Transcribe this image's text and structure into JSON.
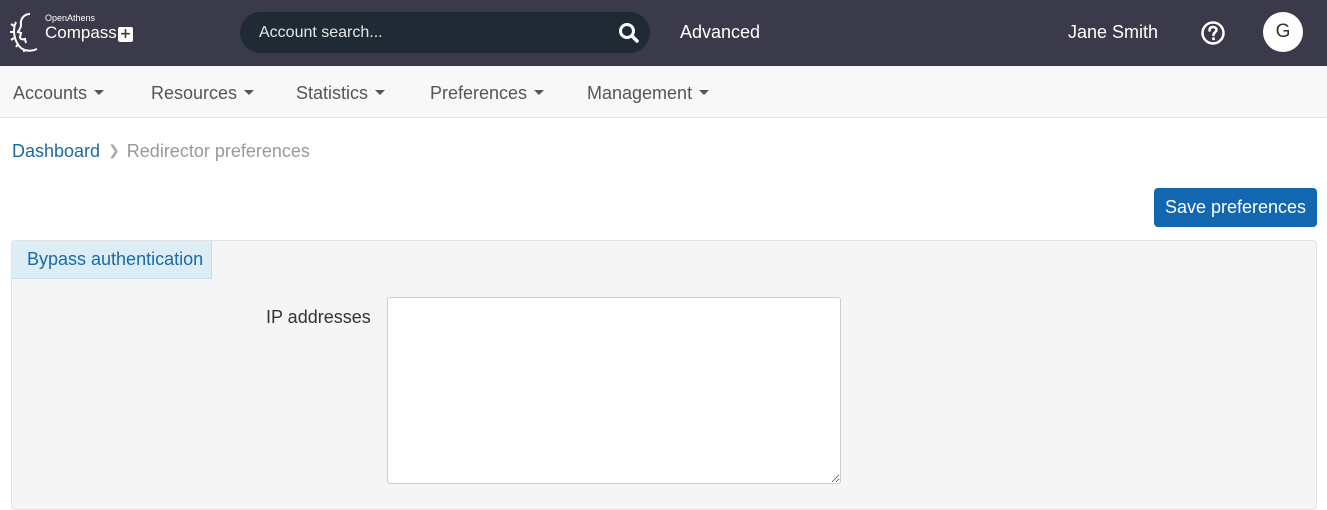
{
  "header": {
    "brand_small": "OpenAthens",
    "brand_name": "Compass",
    "search_placeholder": "Account search...",
    "advanced_label": "Advanced",
    "user_name": "Jane Smith",
    "avatar_initial": "G",
    "icons": {
      "search": "search-icon",
      "help": "help-circle-icon",
      "logo": "laurel-head-icon",
      "plus": "plus-box-icon"
    }
  },
  "nav": {
    "items": [
      {
        "label": "Accounts"
      },
      {
        "label": "Resources"
      },
      {
        "label": "Statistics"
      },
      {
        "label": "Preferences"
      },
      {
        "label": "Management"
      }
    ]
  },
  "breadcrumb": {
    "parent": "Dashboard",
    "current": "Redirector preferences"
  },
  "actions": {
    "save_label": "Save preferences"
  },
  "panel": {
    "tab_label": "Bypass authentication",
    "field_label": "IP addresses",
    "field_value": ""
  },
  "colors": {
    "header_bg": "#3b3a4a",
    "search_bg": "#1f2a35",
    "primary": "#1267b0",
    "link": "#1a6aa6",
    "tab_bg": "#dcedf6"
  }
}
